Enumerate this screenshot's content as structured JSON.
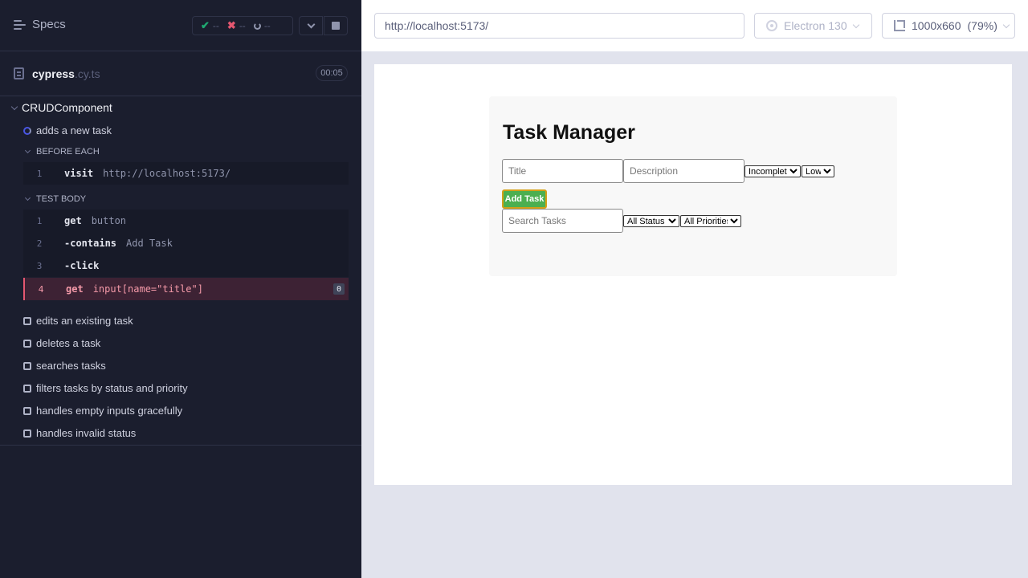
{
  "reporter": {
    "specs_label": "Specs",
    "stats": {
      "passed": "--",
      "failed": "--",
      "pending": "--"
    },
    "spec": {
      "name": "cypress",
      "ext": ".cy.ts",
      "duration": "00:05"
    },
    "suite_title": "CRUDComponent",
    "active_test": "adds a new task",
    "before_each": {
      "title": "BEFORE EACH",
      "commands": [
        {
          "num": "1",
          "name": "visit",
          "msg": "http://localhost:5173/"
        }
      ]
    },
    "test_body": {
      "title": "TEST BODY",
      "commands": [
        {
          "num": "1",
          "name": "get",
          "msg": "button"
        },
        {
          "num": "2",
          "name": "-contains",
          "msg": "Add Task"
        },
        {
          "num": "3",
          "name": "-click",
          "msg": ""
        },
        {
          "num": "4",
          "name": "get",
          "msg": "input[name=\"title\"]",
          "badge": "0"
        }
      ]
    },
    "pending_tests": [
      "edits an existing task",
      "deletes a task",
      "searches tasks",
      "filters tasks by status and priority",
      "handles empty inputs gracefully",
      "handles invalid status"
    ]
  },
  "topbar": {
    "url": "http://localhost:5173/",
    "browser": "Electron 130",
    "viewport": "1000x660",
    "zoom": "(79%)"
  },
  "app": {
    "heading": "Task Manager",
    "title_placeholder": "Title",
    "description_placeholder": "Description",
    "status_selected": "Incomplete",
    "priority_selected": "Low",
    "add_button": "Add Task",
    "search_placeholder": "Search Tasks",
    "status_filter": "All Status",
    "priority_filter": "All Priorities"
  },
  "colors": {
    "reporter_bg": "#1b1e2e",
    "pass": "#1fa971",
    "fail": "#e45770",
    "add_button_bg": "#4caf50"
  }
}
